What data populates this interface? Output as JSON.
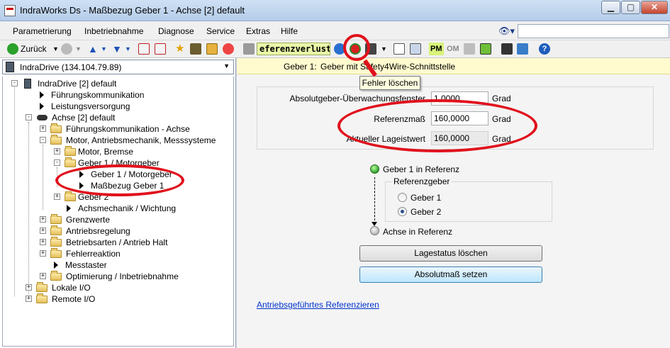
{
  "window": {
    "title": "IndraWorks Ds - Maßbezug Geber 1 - Achse [2] default",
    "minimize_label": "▁",
    "maximize_label": "▢",
    "close_label": "✕"
  },
  "menu": {
    "items": [
      "Parametrierung",
      "Inbetriebnahme",
      "Diagnose",
      "Service",
      "Extras",
      "Hilfe"
    ]
  },
  "toolbar": {
    "back_label": "Zurück",
    "error_text": "eferenzverlust",
    "pm_label": "PM",
    "om_label": "OM"
  },
  "device": {
    "combo_label": "IndraDrive (134.104.79.89)"
  },
  "tree": {
    "nodes": [
      "IndraDrive [2] default",
      "Führungskommunikation",
      "Leistungsversorgung",
      "Achse [2] default",
      "Führungskommunikation - Achse",
      "Motor, Antriebsmechanik, Messsysteme",
      "Motor, Bremse",
      "Geber 1 / Motorgeber",
      "Geber 1 / Motorgeber",
      "Maßbezug Geber 1",
      "Geber 2",
      "Achsmechanik / Wichtung",
      "Grenzwerte",
      "Antriebsregelung",
      "Betriebsarten / Antrieb Halt",
      "Fehlerreaktion",
      "Messtaster",
      "Optimierung / Inbetriebnahme",
      "Lokale I/O",
      "Remote I/O"
    ]
  },
  "header": {
    "encoder_label": "Geber 1:",
    "encoder_desc": "Geber mit Safety4Wire-Schnittstelle"
  },
  "tooltip": {
    "text": "Fehler löschen"
  },
  "params": {
    "window_label": "Absolutgeber-Überwachungsfenster",
    "window_value": "1,0000",
    "refmass_label": "Referenzmaß",
    "refmass_value": "160,0000",
    "position_label": "Aktueller Lageistwert",
    "position_value": "160,0000",
    "unit": "Grad"
  },
  "reference": {
    "encoder_in_ref": "Geber 1 in Referenz",
    "group_title": "Referenzgeber",
    "option1": "Geber 1",
    "option2": "Geber 2",
    "selected": "Geber 2",
    "axis_in_ref": "Achse in Referenz"
  },
  "buttons": {
    "clear_position": "Lagestatus löschen",
    "set_absolute": "Absolutmaß setzen"
  },
  "link": {
    "text": "Antriebsgeführtes Referenzieren"
  },
  "colors": {
    "annotation": "#e0121c",
    "header_bg": "#fffbcf",
    "error_combo_bg": "#e9f6a8",
    "link": "#0033cc"
  }
}
